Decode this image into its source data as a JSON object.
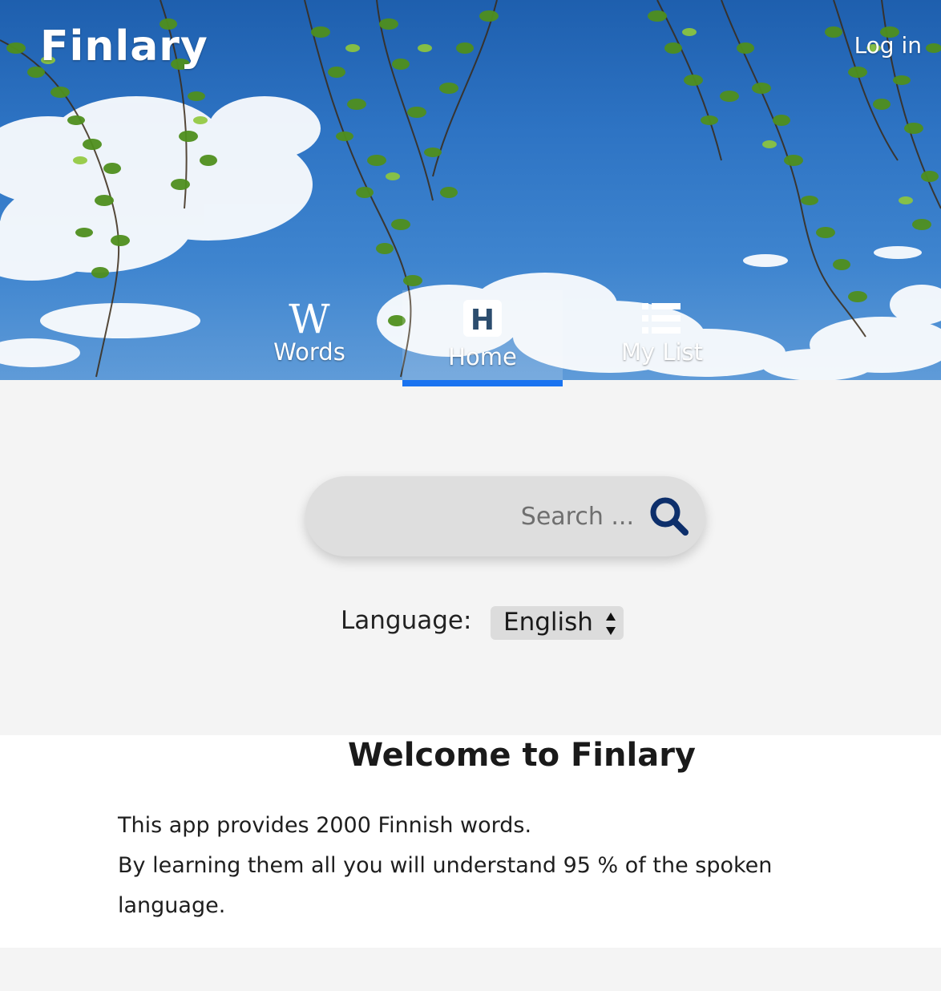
{
  "header": {
    "brand": "Finlary",
    "login_label": "Log in"
  },
  "nav": {
    "tabs": [
      {
        "label": "Words",
        "icon": "wikipedia-w-icon",
        "active": false
      },
      {
        "label": "Home",
        "icon": "home-h-icon",
        "active": true
      },
      {
        "label": "My List",
        "icon": "list-icon",
        "active": false
      }
    ]
  },
  "search": {
    "placeholder": "Search ...",
    "value": "",
    "icon": "search-icon"
  },
  "language": {
    "label": "Language:",
    "selected": "English"
  },
  "welcome": {
    "title": "Welcome to Finlary",
    "line1": "This app provides 2000 Finnish words.",
    "line2": "By learning them all you will understand 95 % of the spoken language."
  },
  "colors": {
    "accent": "#1a73f0",
    "search_icon": "#0d2f6b",
    "sky": "#2e74c4"
  }
}
